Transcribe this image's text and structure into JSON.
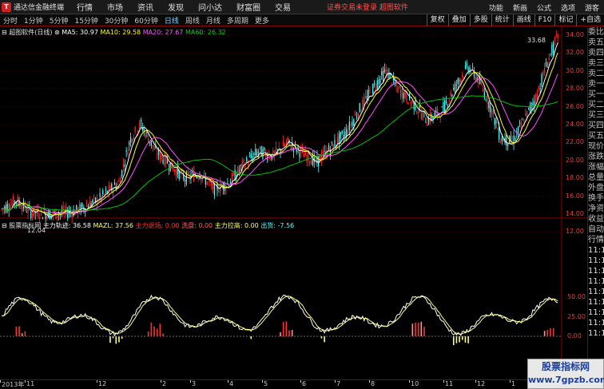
{
  "app": {
    "name": "通达信金融终端",
    "logo_letter": "T"
  },
  "menu": [
    "行情",
    "市场",
    "资讯",
    "发现",
    "问小达",
    "财富圈",
    "交易"
  ],
  "notice": "证券交易未登录  超图软件",
  "right_menu": [
    "功能",
    "新画",
    "公式",
    "选项",
    "游客"
  ],
  "periods": [
    "分时",
    "1分钟",
    "5分钟",
    "15分钟",
    "30分钟",
    "60分钟",
    "日线",
    "周线",
    "月线",
    "多周期",
    "更多"
  ],
  "active_period": "日线",
  "tool_buttons": [
    "复权",
    "叠加",
    "多股",
    "统计",
    "画线",
    "F10",
    "标记",
    "+自选"
  ],
  "main_legend": {
    "name": "超图软件(日线)",
    "ma5": "MA5: 30.97",
    "ma10": "MA10: 29.58",
    "ma20": "MA20: 27.67",
    "ma60": "MA60: 26.32"
  },
  "price_axis": [
    "34.00",
    "32.00",
    "30.00",
    "28.00",
    "26.00",
    "24.00",
    "22.00",
    "20.00",
    "18.00",
    "16.00",
    "14.00",
    "12.00"
  ],
  "high_label": "33.68",
  "low_label": "12.04",
  "indicator_legend": {
    "name": "股票指标网",
    "main_track": "主力轨迹: 36.58",
    "mazl": "MAZL: 37.56",
    "retreat": "主力退场: 0.00",
    "wash": "洗盘: 0.00",
    "pull": "主力拉高: 0.00",
    "out": "出货: -7.56"
  },
  "indicator_axis": [
    "50.00",
    "25.00",
    "0.00"
  ],
  "right_panel": [
    "委比",
    "卖五",
    "卖四",
    "卖三",
    "卖二",
    "卖一",
    "买一",
    "买二",
    "买三",
    "买四",
    "买五",
    "现价",
    "涨跌",
    "涨幅",
    "总量",
    "外盘",
    "换手",
    "净资",
    "收益",
    "自动",
    "行情",
    "11:15",
    "11:15",
    "11:15",
    "11:15",
    "11:15",
    "11:15",
    "11:15",
    "11:15",
    "11:1"
  ],
  "time_axis": [
    {
      "label": "2013年",
      "pos": 2
    },
    {
      "label": "11",
      "pos": 33
    },
    {
      "label": "12",
      "pos": 123
    },
    {
      "label": "2",
      "pos": 203
    },
    {
      "label": "3",
      "pos": 240
    },
    {
      "label": "4",
      "pos": 287
    },
    {
      "label": "5",
      "pos": 330
    },
    {
      "label": "6",
      "pos": 378
    },
    {
      "label": "7",
      "pos": 421
    },
    {
      "label": "8",
      "pos": 464
    },
    {
      "label": "10",
      "pos": 514
    },
    {
      "label": "11",
      "pos": 557
    },
    {
      "label": "12",
      "pos": 597
    },
    {
      "label": "1",
      "pos": 640
    }
  ],
  "watermark": {
    "line1": "股票指标网",
    "line2": "www.7gpzb.com"
  },
  "colors": {
    "up": "#ff3030",
    "down": "#54ffff",
    "ma5": "#ffffff",
    "ma10": "#ffff00",
    "ma20": "#ff50ff",
    "ma60": "#00c000",
    "yellow_bar": "#ffff80",
    "red_bar": "#ff3030",
    "pink_bar": "#ff9090"
  }
}
